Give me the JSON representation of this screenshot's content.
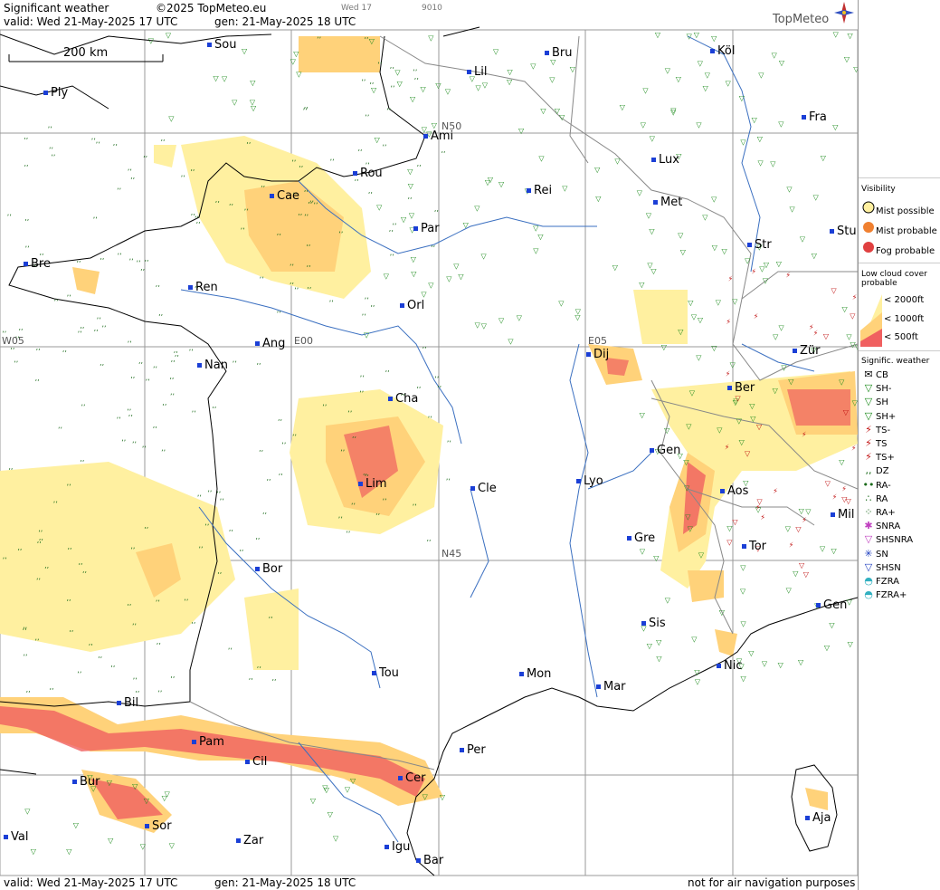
{
  "header": {
    "title": "Significant weather",
    "copyright": "©2025 TopMeteo.eu",
    "valid": "valid:  Wed  21-May-2025  17 UTC",
    "gen": "gen: 21-May-2025 18 UTC",
    "day_small": "Wed 17",
    "code_small": "9010",
    "brand": "TopMeteo"
  },
  "scale_bar": {
    "label": "200 km"
  },
  "grid_labels": [
    "N50",
    "N45",
    "W05",
    "E00",
    "E05"
  ],
  "cities": [
    "Sou",
    "Köl",
    "Lil",
    "Bru",
    "Ply",
    "Ami",
    "Fra",
    "Lux",
    "Rou",
    "Cae",
    "Rei",
    "Met",
    "Bre",
    "Par",
    "Stu",
    "Str",
    "Ren",
    "Orl",
    "Zür",
    "Ang",
    "Nan",
    "Dij",
    "Ber",
    "Cha",
    "Gen",
    "Lim",
    "Cle",
    "Lyo",
    "Aos",
    "Mil",
    "Gre",
    "Tor",
    "Bor",
    "Gen",
    "Sis",
    "Nic",
    "Tou",
    "Mon",
    "Mar",
    "Bil",
    "Pam",
    "Cil",
    "Per",
    "Bur",
    "Cer",
    "Sor",
    "Aja",
    "Val",
    "Zar",
    "Igu",
    "Bar"
  ],
  "legend": {
    "visibility_title": "Visibility",
    "visibility": [
      "Mist possible",
      "Mist probable",
      "Fog probable"
    ],
    "low_cloud_title": "Low cloud cover probable",
    "low_cloud": [
      "< 2000ft",
      "< 1000ft",
      "<  500ft"
    ],
    "sig_title": "Signific. weather",
    "sig": [
      {
        "label": "CB",
        "sym": "✉",
        "color": "#000000"
      },
      {
        "label": "SH-",
        "sym": "▽",
        "color": "#1a8a1a"
      },
      {
        "label": "SH",
        "sym": "▽",
        "color": "#1a8a1a"
      },
      {
        "label": "SH+",
        "sym": "▽",
        "color": "#1a8a1a"
      },
      {
        "label": "TS-",
        "sym": "⚡",
        "color": "#c01010"
      },
      {
        "label": "TS",
        "sym": "⚡",
        "color": "#c01010"
      },
      {
        "label": "TS+",
        "sym": "⚡",
        "color": "#c01010"
      },
      {
        "label": "DZ",
        "sym": ",,",
        "color": "#1a6a1a"
      },
      {
        "label": "RA-",
        "sym": "••",
        "color": "#1a6a1a"
      },
      {
        "label": "RA",
        "sym": "∴",
        "color": "#1a6a1a"
      },
      {
        "label": "RA+",
        "sym": "⁘",
        "color": "#1a6a1a"
      },
      {
        "label": "SNRA",
        "sym": "✱",
        "color": "#c040c0"
      },
      {
        "label": "SHSNRA",
        "sym": "▽",
        "color": "#c040c0"
      },
      {
        "label": "SN",
        "sym": "✳",
        "color": "#2040c0"
      },
      {
        "label": "SHSN",
        "sym": "▽",
        "color": "#2040c0"
      },
      {
        "label": "FZRA",
        "sym": "◓",
        "color": "#30b0c0"
      },
      {
        "label": "FZRA+",
        "sym": "◓",
        "color": "#30b0c0"
      }
    ]
  },
  "footer": {
    "valid": "valid:  Wed  21-May-2025  17 UTC",
    "gen": "gen: 21-May-2025 18 UTC",
    "note": "not for air navigation purposes"
  },
  "colors": {
    "mist_possible": "#fff0a0",
    "mist_probable": "#ffd27a",
    "fog_probable": "#f06060",
    "shower": "#1a8a1a",
    "thunder": "#c01010",
    "coast": "#000000",
    "border": "#888888",
    "river": "#3a6fc0",
    "grid": "#999999"
  }
}
